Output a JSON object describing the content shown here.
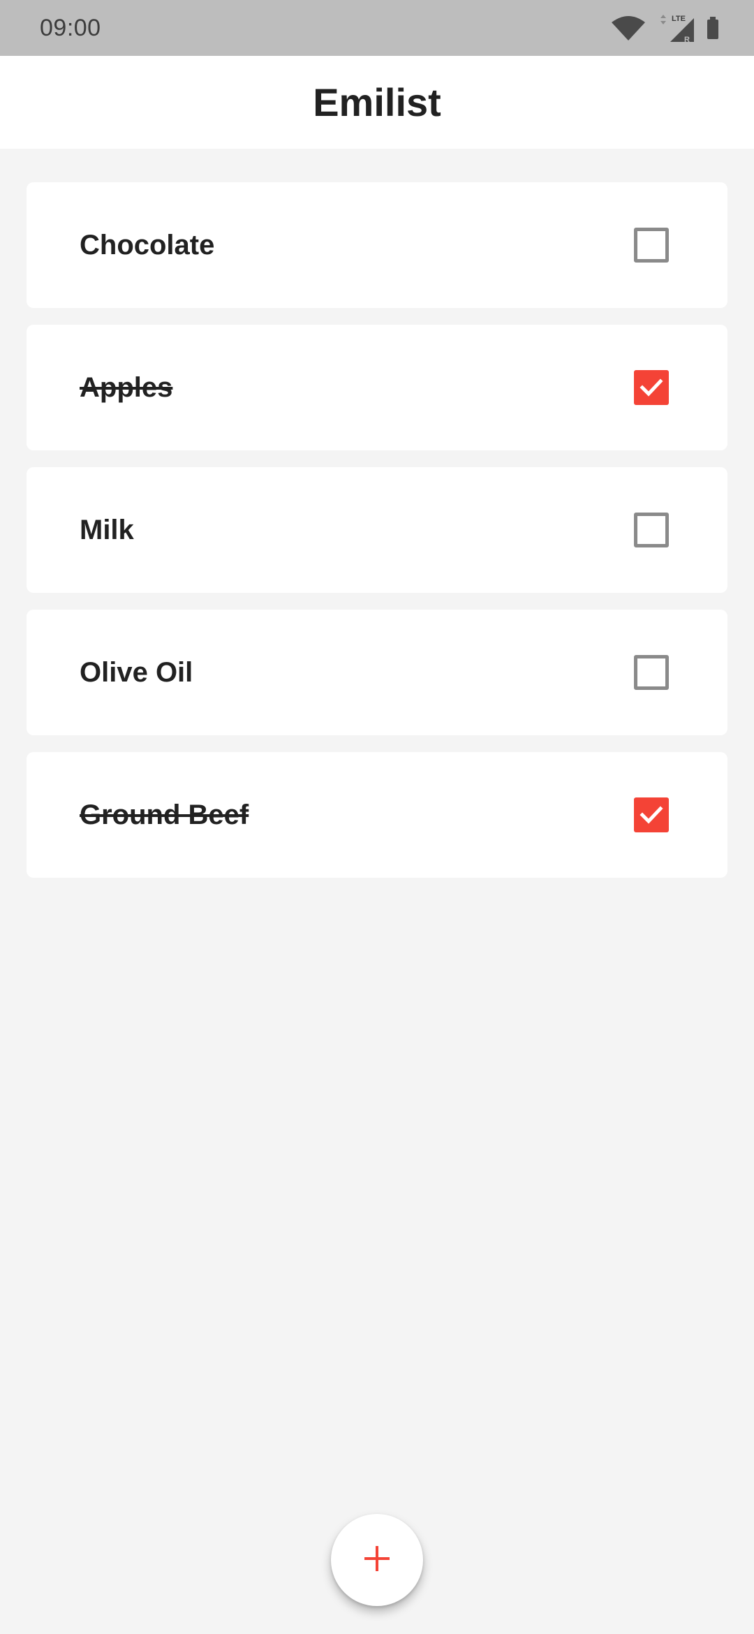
{
  "status_bar": {
    "time": "09:00",
    "icons": [
      "wifi-icon",
      "lte-signal-icon",
      "battery-icon"
    ],
    "network_label": "LTE",
    "roaming_label": "R"
  },
  "app_bar": {
    "title": "Emilist"
  },
  "items": [
    {
      "label": "Chocolate",
      "checked": false
    },
    {
      "label": "Apples",
      "checked": true
    },
    {
      "label": "Milk",
      "checked": false
    },
    {
      "label": "Olive Oil",
      "checked": false
    },
    {
      "label": "Ground Beef",
      "checked": true
    }
  ],
  "fab": {
    "icon": "plus-icon"
  },
  "colors": {
    "accent": "#f44336",
    "status_bar_bg": "#bdbdbd",
    "background": "#f4f4f4",
    "unchecked_border": "#8a8a8a"
  }
}
